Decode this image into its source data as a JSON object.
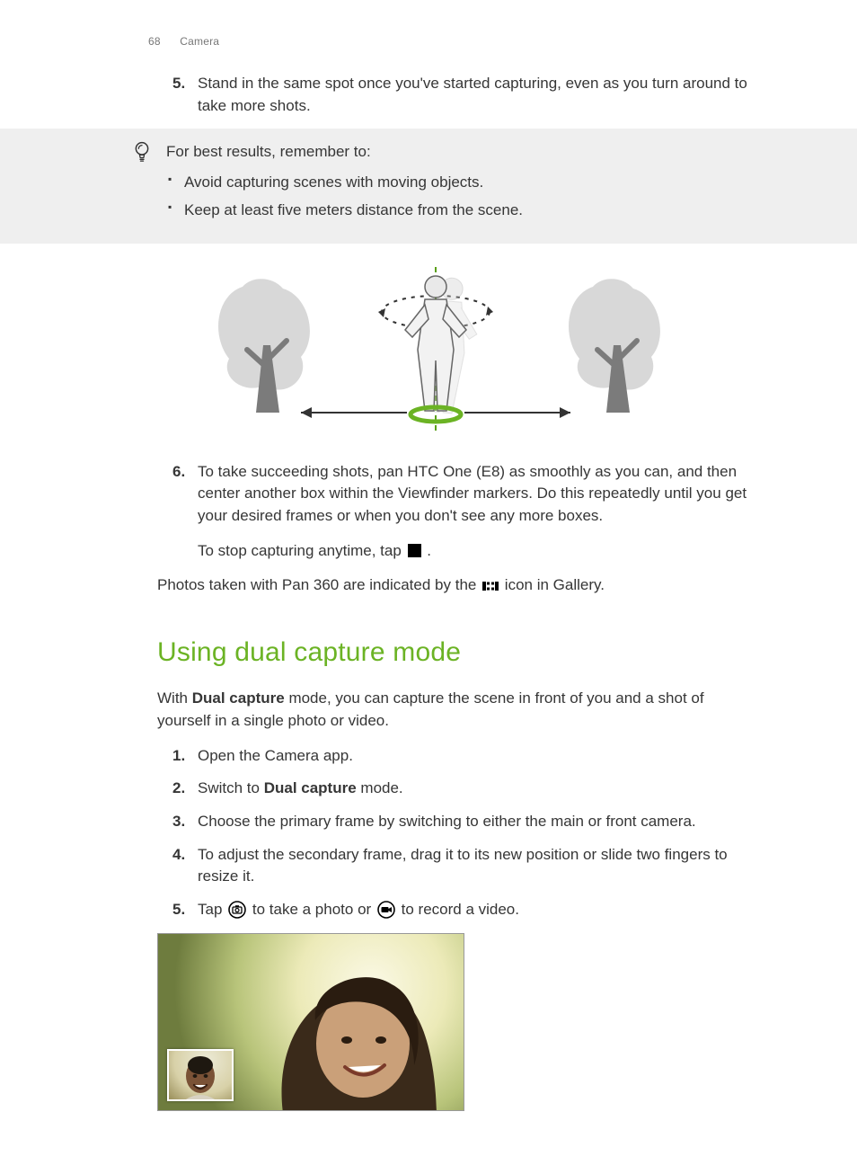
{
  "header": {
    "page_number": "68",
    "section": "Camera"
  },
  "steps_a": {
    "5": "Stand in the same spot once you've started capturing, even as you turn around to take more shots.",
    "6": "To take succeeding shots, pan HTC One (E8) as smoothly as you can, and then center another box within the Viewfinder markers. Do this repeatedly until you get your desired frames or when you don't see any more boxes.",
    "6_extra_before": "To stop capturing anytime, tap ",
    "6_extra_after": " ."
  },
  "tip": {
    "intro": "For best results, remember to:",
    "bullets": {
      "0": "Avoid capturing scenes with moving objects.",
      "1": "Keep at least five meters distance from the scene."
    }
  },
  "pano_line_before": "Photos taken with Pan 360 are indicated by the ",
  "pano_line_after": " icon in Gallery.",
  "section_title": "Using dual capture mode",
  "dual_intro_before": "With ",
  "dual_intro_bold": "Dual capture",
  "dual_intro_after": " mode, you can capture the scene in front of you and a shot of yourself in a single photo or video.",
  "steps_b": {
    "1": "Open the Camera app.",
    "2_before": "Switch to ",
    "2_bold": "Dual capture",
    "2_after": " mode.",
    "3": "Choose the primary frame by switching to either the main or front camera.",
    "4": "To adjust the secondary frame, drag it to its new position or slide two fingers to resize it.",
    "5_a": "Tap ",
    "5_b": " to take a photo or ",
    "5_c": " to record a video."
  }
}
